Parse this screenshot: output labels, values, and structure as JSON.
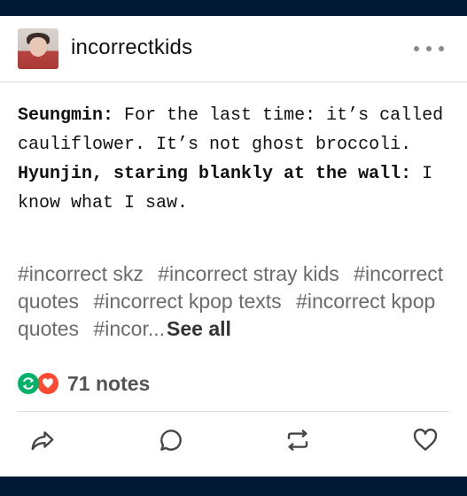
{
  "post": {
    "blog_name": "incorrectkids",
    "dialogue": [
      {
        "speaker": "Seungmin:",
        "line": " For the last time: it’s called cauliflower. It’s not ghost broccoli."
      },
      {
        "speaker": "Hyunjin, staring blankly at the wall:",
        "line": " I know what I saw."
      }
    ],
    "tags": [
      "#incorrect skz",
      "#incorrect stray kids",
      "#incorrect quotes",
      "#incorrect kpop texts",
      "#incorrect kpop quotes",
      "#incor..."
    ],
    "see_all_label": "See all",
    "notes_label": "71 notes"
  },
  "icons": {
    "more": "more-horizontal-icon",
    "share": "share-icon",
    "reply": "reply-bubble-icon",
    "reblog": "reblog-icon",
    "like": "heart-icon"
  },
  "colors": {
    "page_background": "#001935",
    "reblog_green": "#00b16a",
    "like_red": "#ff4930"
  }
}
